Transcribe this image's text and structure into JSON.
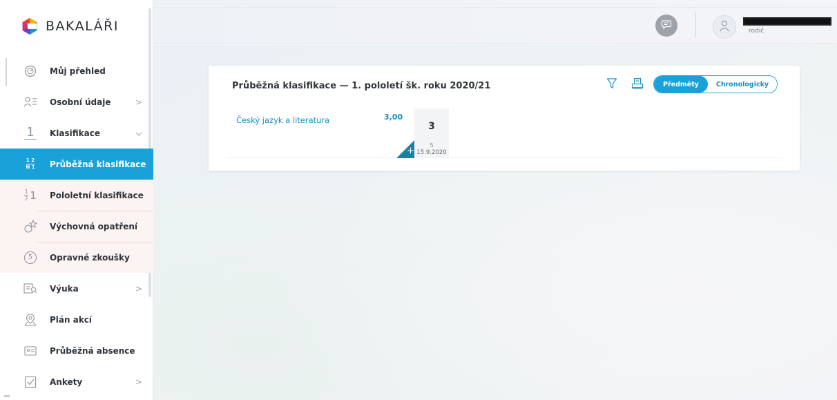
{
  "brand": {
    "name": "BAKALÁŘI"
  },
  "sidebar": {
    "items": [
      {
        "label": "Můj přehled",
        "icon": "gauge-icon",
        "chevron": ""
      },
      {
        "label": "Osobní údaje",
        "icon": "id-card-icon",
        "chevron": ">"
      },
      {
        "label": "Klasifikace",
        "icon": "grade-one-icon",
        "chevron": "⌄"
      },
      {
        "label": "Průběžná klasifikace",
        "icon": "fraction-icon",
        "chevron": "",
        "active": true
      },
      {
        "label": "Pololetní klasifikace",
        "icon": "half-grade-icon",
        "chevron": ""
      },
      {
        "label": "Výchovná opatření",
        "icon": "medal-icon",
        "chevron": ""
      },
      {
        "label": "Opravné zkoušky",
        "icon": "retake-icon",
        "chevron": ""
      },
      {
        "label": "Výuka",
        "icon": "book-icon",
        "chevron": ">"
      },
      {
        "label": "Plán akcí",
        "icon": "map-pin-icon",
        "chevron": ""
      },
      {
        "label": "Průběžná absence",
        "icon": "absence-icon",
        "chevron": ""
      },
      {
        "label": "Ankety",
        "icon": "checkbox-icon",
        "chevron": ">"
      }
    ],
    "fraction_icon": {
      "top": "1 2",
      "bottom": "N 1"
    },
    "half_icon": {
      "top": "1",
      "bottom": "2",
      "digit": "1"
    },
    "grade_one_glyph": "1",
    "retake_glyph": "5"
  },
  "topbar": {
    "user_role": "rodič",
    "icons": [
      "message-icon",
      "user-icon"
    ]
  },
  "card": {
    "title": "Průběžná klasifikace  —  1. pololetí šk. roku 2020/21",
    "view_toggle": {
      "selected": "Předměty",
      "other": "Chronologicky"
    },
    "rows": [
      {
        "subject": "Český jazyk a literatura",
        "average": "3,00",
        "grades": [
          {
            "value": "3",
            "weight": "5",
            "date": "15.9.2020",
            "corner": "+"
          }
        ]
      }
    ]
  },
  "colors": {
    "accent": "#1aa1d9",
    "link": "#1a8fc4",
    "corner": "#1b7fa8"
  }
}
